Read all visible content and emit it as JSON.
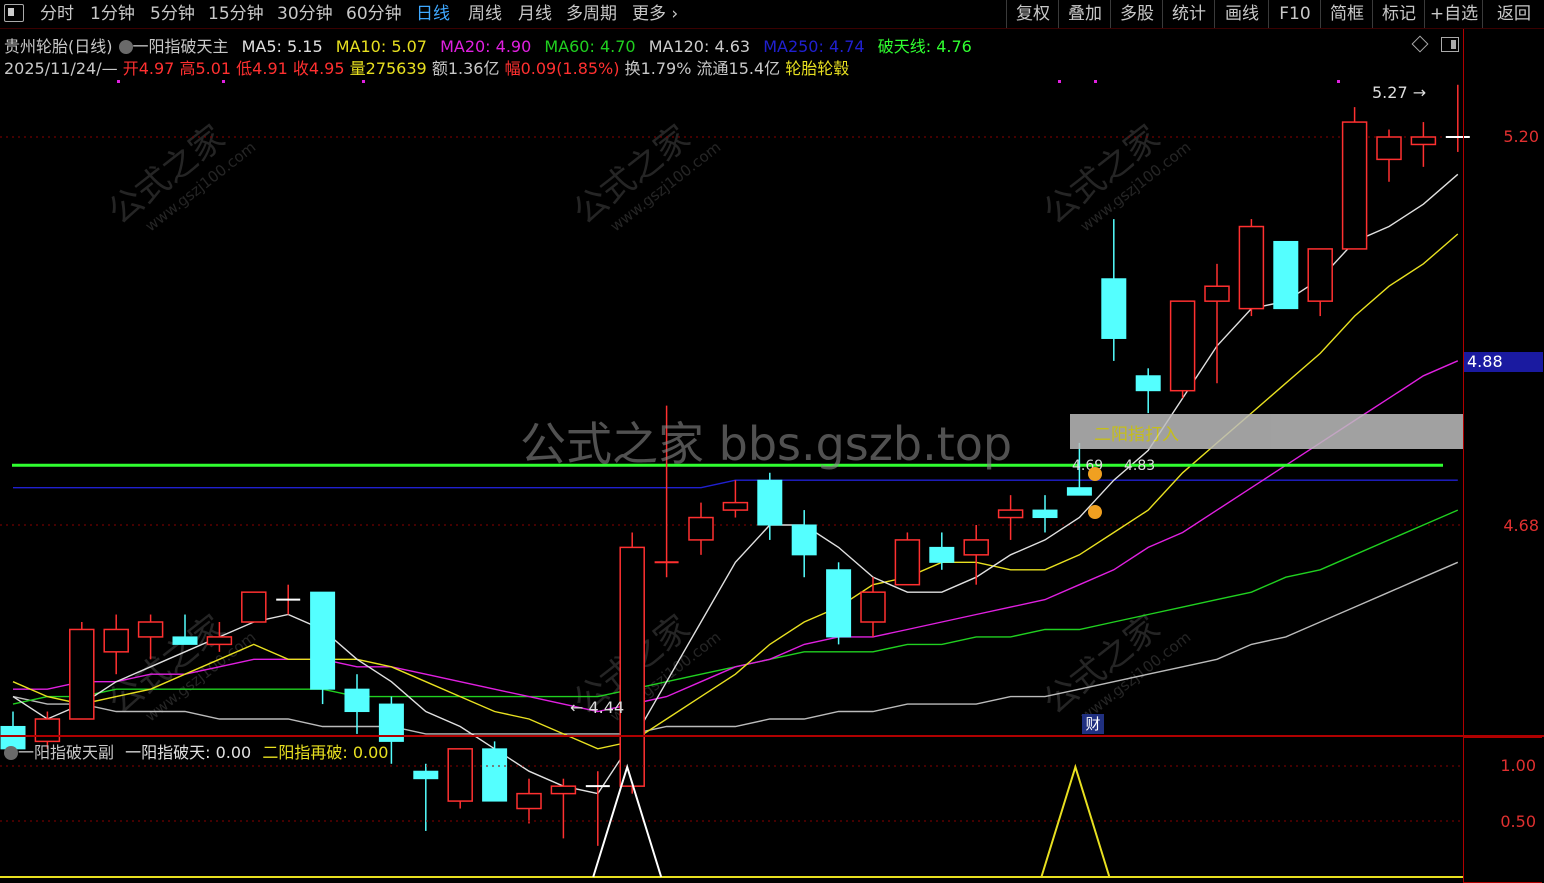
{
  "toolbar": {
    "menu_icon": "menu-icon",
    "periods": [
      "分时",
      "1分钟",
      "5分钟",
      "15分钟",
      "30分钟",
      "60分钟",
      "日线",
      "周线",
      "月线",
      "多周期",
      "更多"
    ],
    "active_period": "日线",
    "right_buttons": [
      "复权",
      "叠加",
      "多股",
      "统计",
      "画线",
      "F10",
      "简框",
      "标记",
      "+自选",
      "返回"
    ]
  },
  "info": {
    "stock": "贵州轮胎(日线)",
    "formula": "一阳指破天主",
    "ma5_label": "MA5:",
    "ma5": "5.15",
    "ma10_label": "MA10:",
    "ma10": "5.07",
    "ma20_label": "MA20:",
    "ma20": "4.90",
    "ma60_label": "MA60:",
    "ma60": "4.70",
    "ma120_label": "MA120:",
    "ma120": "4.63",
    "ma250_label": "MA250:",
    "ma250": "4.74",
    "potian_label": "破天线:",
    "potian": "4.76",
    "date": "2025/11/24/—",
    "open": "开4.97",
    "high": "高5.01",
    "low": "低4.91",
    "close": "收4.95",
    "vol": "量275639",
    "amount": "额1.36亿",
    "change": "幅0.09(1.85%)",
    "turnover": "换1.79%",
    "float": "流通15.4亿",
    "sector": "轮胎轮毂"
  },
  "colors": {
    "up": "#ff3030",
    "down": "#54ffff",
    "ma5": "#e0e0e0",
    "ma10": "#e8e020",
    "ma20": "#e020e0",
    "ma60": "#20d020",
    "ma120": "#bbbbbb",
    "ma250": "#2020d0",
    "potian": "#30ff30"
  },
  "axis": {
    "labels": [
      "5.20",
      "4.68"
    ],
    "current": "4.88"
  },
  "annotations": {
    "high_label": "5.27",
    "low_label": "4.44",
    "line_vals_a": "4.69",
    "line_vals_b": "4.83",
    "tooltip": "二阳指打入",
    "watermark_center": "公式之家 bbs.gszb.top",
    "watermark": "公式之家",
    "watermark_url": "www.gszj100.com",
    "cai_badge": "财"
  },
  "sub": {
    "title": "一阳指破天副",
    "s1_label": "一阳指破天:",
    "s1": "0.00",
    "s2_label": "二阳指再破:",
    "s2": "0.00",
    "axis": [
      "1.00",
      "0.50"
    ]
  },
  "chart_data": {
    "type": "candlestick",
    "candles": [
      {
        "o": 4.41,
        "h": 4.43,
        "l": 4.37,
        "c": 4.38
      },
      {
        "o": 4.39,
        "h": 4.43,
        "l": 4.38,
        "c": 4.42
      },
      {
        "o": 4.42,
        "h": 4.55,
        "l": 4.42,
        "c": 4.54
      },
      {
        "o": 4.51,
        "h": 4.56,
        "l": 4.48,
        "c": 4.54
      },
      {
        "o": 4.53,
        "h": 4.56,
        "l": 4.5,
        "c": 4.55
      },
      {
        "o": 4.53,
        "h": 4.56,
        "l": 4.52,
        "c": 4.52
      },
      {
        "o": 4.52,
        "h": 4.55,
        "l": 4.51,
        "c": 4.53
      },
      {
        "o": 4.55,
        "h": 4.59,
        "l": 4.55,
        "c": 4.59
      },
      {
        "o": 4.58,
        "h": 4.6,
        "l": 4.56,
        "c": 4.58
      },
      {
        "o": 4.59,
        "h": 4.59,
        "l": 4.44,
        "c": 4.46
      },
      {
        "o": 4.46,
        "h": 4.48,
        "l": 4.4,
        "c": 4.43
      },
      {
        "o": 4.44,
        "h": 4.45,
        "l": 4.36,
        "c": 4.39
      },
      {
        "o": 4.35,
        "h": 4.36,
        "l": 4.27,
        "c": 4.34
      },
      {
        "o": 4.31,
        "h": 4.38,
        "l": 4.3,
        "c": 4.38
      },
      {
        "o": 4.38,
        "h": 4.39,
        "l": 4.31,
        "c": 4.31
      },
      {
        "o": 4.3,
        "h": 4.34,
        "l": 4.28,
        "c": 4.32
      },
      {
        "o": 4.32,
        "h": 4.34,
        "l": 4.26,
        "c": 4.33
      },
      {
        "o": 4.33,
        "h": 4.35,
        "l": 4.25,
        "c": 4.33
      },
      {
        "o": 4.33,
        "h": 4.67,
        "l": 4.32,
        "c": 4.65
      },
      {
        "o": 4.63,
        "h": 4.84,
        "l": 4.61,
        "c": 4.63
      },
      {
        "o": 4.66,
        "h": 4.71,
        "l": 4.64,
        "c": 4.69
      },
      {
        "o": 4.7,
        "h": 4.74,
        "l": 4.69,
        "c": 4.71
      },
      {
        "o": 4.74,
        "h": 4.75,
        "l": 4.66,
        "c": 4.68
      },
      {
        "o": 4.68,
        "h": 4.7,
        "l": 4.61,
        "c": 4.64
      },
      {
        "o": 4.62,
        "h": 4.63,
        "l": 4.52,
        "c": 4.53
      },
      {
        "o": 4.55,
        "h": 4.61,
        "l": 4.53,
        "c": 4.59
      },
      {
        "o": 4.6,
        "h": 4.67,
        "l": 4.6,
        "c": 4.66
      },
      {
        "o": 4.65,
        "h": 4.67,
        "l": 4.62,
        "c": 4.63
      },
      {
        "o": 4.64,
        "h": 4.68,
        "l": 4.6,
        "c": 4.66
      },
      {
        "o": 4.69,
        "h": 4.72,
        "l": 4.66,
        "c": 4.7
      },
      {
        "o": 4.7,
        "h": 4.72,
        "l": 4.67,
        "c": 4.69
      },
      {
        "o": 4.73,
        "h": 4.79,
        "l": 4.73,
        "c": 4.72
      },
      {
        "o": 5.01,
        "h": 5.09,
        "l": 4.9,
        "c": 4.93
      },
      {
        "o": 4.88,
        "h": 4.89,
        "l": 4.83,
        "c": 4.86
      },
      {
        "o": 4.86,
        "h": 4.98,
        "l": 4.85,
        "c": 4.98
      },
      {
        "o": 4.98,
        "h": 5.03,
        "l": 4.87,
        "c": 5.0
      },
      {
        "o": 4.97,
        "h": 5.09,
        "l": 4.96,
        "c": 5.08
      },
      {
        "o": 5.06,
        "h": 5.06,
        "l": 4.97,
        "c": 4.97
      },
      {
        "o": 4.98,
        "h": 5.05,
        "l": 4.96,
        "c": 5.05
      },
      {
        "o": 5.05,
        "h": 5.24,
        "l": 5.05,
        "c": 5.22
      },
      {
        "o": 5.17,
        "h": 5.21,
        "l": 5.14,
        "c": 5.2
      },
      {
        "o": 5.19,
        "h": 5.22,
        "l": 5.16,
        "c": 5.2
      },
      {
        "o": 5.2,
        "h": 5.27,
        "l": 5.18,
        "c": 5.2
      }
    ],
    "ma5": [
      4.45,
      4.42,
      4.44,
      4.47,
      4.49,
      4.51,
      4.53,
      4.55,
      4.56,
      4.54,
      4.5,
      4.47,
      4.43,
      4.41,
      4.38,
      4.35,
      4.33,
      4.32,
      4.39,
      4.47,
      4.55,
      4.63,
      4.68,
      4.68,
      4.65,
      4.61,
      4.59,
      4.59,
      4.61,
      4.64,
      4.66,
      4.69,
      4.74,
      4.78,
      4.85,
      4.92,
      4.97,
      4.98,
      5.01,
      5.06,
      5.08,
      5.11,
      5.15
    ],
    "ma10": [
      4.47,
      4.45,
      4.44,
      4.45,
      4.46,
      4.48,
      4.5,
      4.52,
      4.5,
      4.5,
      4.5,
      4.49,
      4.47,
      4.45,
      4.43,
      4.42,
      4.4,
      4.38,
      4.39,
      4.42,
      4.45,
      4.48,
      4.52,
      4.55,
      4.57,
      4.6,
      4.61,
      4.63,
      4.63,
      4.62,
      4.62,
      4.64,
      4.67,
      4.7,
      4.75,
      4.79,
      4.83,
      4.87,
      4.91,
      4.96,
      5.0,
      5.03,
      5.07
    ],
    "ma20": [
      4.46,
      4.46,
      4.47,
      4.47,
      4.48,
      4.48,
      4.49,
      4.5,
      4.5,
      4.5,
      4.49,
      4.49,
      4.48,
      4.47,
      4.46,
      4.45,
      4.44,
      4.43,
      4.44,
      4.45,
      4.47,
      4.49,
      4.5,
      4.52,
      4.53,
      4.53,
      4.54,
      4.55,
      4.56,
      4.57,
      4.58,
      4.6,
      4.62,
      4.65,
      4.67,
      4.7,
      4.73,
      4.76,
      4.79,
      4.82,
      4.85,
      4.88,
      4.9
    ],
    "ma60": [
      4.44,
      4.45,
      4.45,
      4.46,
      4.46,
      4.46,
      4.46,
      4.46,
      4.46,
      4.46,
      4.45,
      4.45,
      4.45,
      4.45,
      4.45,
      4.45,
      4.45,
      4.45,
      4.46,
      4.47,
      4.48,
      4.49,
      4.5,
      4.51,
      4.51,
      4.51,
      4.52,
      4.52,
      4.53,
      4.53,
      4.54,
      4.54,
      4.55,
      4.56,
      4.57,
      4.58,
      4.59,
      4.61,
      4.62,
      4.64,
      4.66,
      4.68,
      4.7
    ],
    "ma120": [
      4.45,
      4.44,
      4.44,
      4.43,
      4.43,
      4.43,
      4.42,
      4.42,
      4.42,
      4.41,
      4.41,
      4.41,
      4.4,
      4.4,
      4.4,
      4.4,
      4.4,
      4.4,
      4.4,
      4.41,
      4.41,
      4.41,
      4.42,
      4.42,
      4.43,
      4.43,
      4.44,
      4.44,
      4.44,
      4.45,
      4.45,
      4.46,
      4.47,
      4.48,
      4.49,
      4.5,
      4.52,
      4.53,
      4.55,
      4.57,
      4.59,
      4.61,
      4.63
    ],
    "ma250": [
      4.73,
      4.73,
      4.73,
      4.73,
      4.73,
      4.73,
      4.73,
      4.73,
      4.73,
      4.73,
      4.73,
      4.73,
      4.73,
      4.73,
      4.73,
      4.73,
      4.73,
      4.73,
      4.73,
      4.73,
      4.73,
      4.74,
      4.74,
      4.74,
      4.74,
      4.74,
      4.74,
      4.74,
      4.74,
      4.74,
      4.74,
      4.74,
      4.74,
      4.74,
      4.74,
      4.74,
      4.74,
      4.74,
      4.74,
      4.74,
      4.74,
      4.74,
      4.74
    ],
    "potian": 4.76,
    "sub_signal_white": [
      0,
      0,
      0,
      0,
      0,
      0,
      0,
      0,
      0,
      0,
      0,
      0,
      0,
      0,
      0,
      0,
      0,
      0,
      1,
      0,
      0,
      0,
      0,
      0,
      0,
      0,
      0,
      0,
      0,
      0,
      0,
      0,
      0,
      0,
      0,
      0,
      0,
      0,
      0,
      0,
      0,
      0,
      0
    ],
    "sub_signal_yellow": [
      0,
      0,
      0,
      0,
      0,
      0,
      0,
      0,
      0,
      0,
      0,
      0,
      0,
      0,
      0,
      0,
      0,
      0,
      0,
      0,
      0,
      0,
      0,
      0,
      0,
      0,
      0,
      0,
      0,
      0,
      0,
      1,
      0,
      0,
      0,
      0,
      0,
      0,
      0,
      0,
      0,
      0,
      0
    ]
  }
}
